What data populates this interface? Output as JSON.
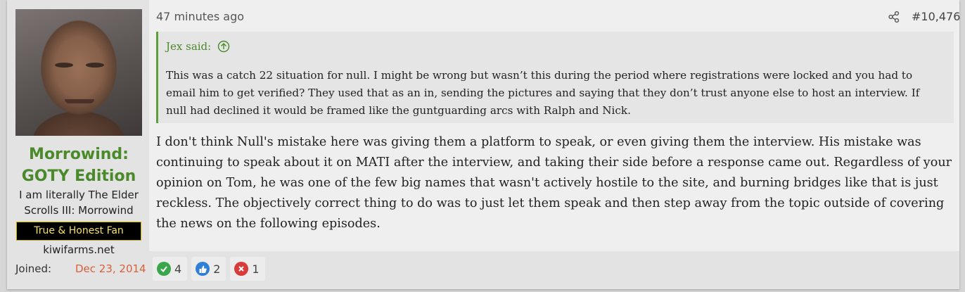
{
  "user": {
    "name": "Morrowind: GOTY Edition",
    "title": "I am literally The Elder Scrolls III: Morrowind",
    "banner": "True & Honest Fan",
    "site": "kiwifarms.net",
    "joined_label": "Joined:",
    "joined_value": "Dec 23, 2014"
  },
  "post": {
    "time": "47 minutes ago",
    "number": "#10,476",
    "quote": {
      "author_line": "Jex said:",
      "text": "This was a catch 22 situation for null. I might be wrong but wasn’t this during the period where registrations were locked and you had to email him to get verified? They used that as an in, sending the pictures and saying that they don’t trust anyone else to host an interview. If null had declined it would be framed like the guntguarding arcs with Ralph and Nick."
    },
    "message": "I don't think Null's mistake here was giving them a platform to speak, or even giving them the interview. His mistake was continuing to speak about it on MATI after the interview, and taking their side before a response came out. Regardless of your opinion on Tom, he was one of the few big names that wasn't actively hostile to the site, and burning bridges like that is just reckless. The objectively correct thing to do was to just let them speak and then step away from the topic outside of covering the news on the following episodes."
  },
  "reactions": [
    {
      "icon": "check-icon",
      "count": "4",
      "color": "#3aa64a"
    },
    {
      "icon": "thumbs-up-icon",
      "count": "2",
      "color": "#2f7fd6"
    },
    {
      "icon": "x-icon",
      "count": "1",
      "color": "#d93a3a"
    }
  ],
  "colors": {
    "accent": "#4a8a2a",
    "joined": "#d9603b",
    "banner_text": "#f5e16a"
  }
}
